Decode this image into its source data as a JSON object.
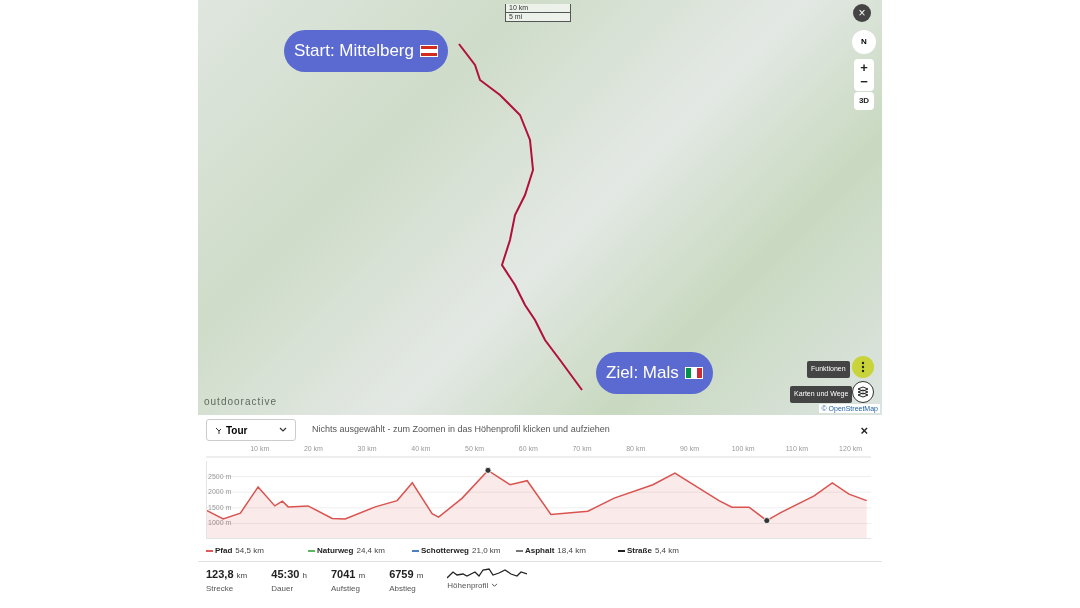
{
  "map": {
    "scale": [
      "10 km",
      "5 mi"
    ],
    "callouts": [
      {
        "text": "Start: Mittelberg",
        "kind": "start"
      },
      {
        "text": "Ziel: Mals",
        "kind": "end"
      }
    ],
    "controls": {
      "close": "×",
      "compass": "N",
      "zoom_in": "+",
      "zoom_out": "−",
      "mode": "3D"
    },
    "tooltips": [
      {
        "text": "Funktionen",
        "kind": "menu"
      },
      {
        "text": "Karten und Wege",
        "kind": "layers"
      }
    ],
    "logo": "outdooractive",
    "attribution": "© OpenStreetMap"
  },
  "profile": {
    "dropdown": "Tour",
    "hint": "Nichts ausgewählt - zum Zoomen in das Höhenprofil klicken und aufziehen",
    "close": "×",
    "chart_data": {
      "type": "area",
      "grid": true,
      "xlim": [
        0,
        123.8
      ],
      "ylim": [
        500,
        3000
      ],
      "xticks": [
        {
          "value": 10,
          "label": "10 km"
        },
        {
          "value": 20,
          "label": "20 km"
        },
        {
          "value": 30,
          "label": "30 km"
        },
        {
          "value": 40,
          "label": "40 km"
        },
        {
          "value": 50,
          "label": "50 km"
        },
        {
          "value": 60,
          "label": "60 km"
        },
        {
          "value": 70,
          "label": "70 km"
        },
        {
          "value": 80,
          "label": "80 km"
        },
        {
          "value": 90,
          "label": "90 km"
        },
        {
          "value": 100,
          "label": "100 km"
        },
        {
          "value": 110,
          "label": "110 km"
        },
        {
          "value": 120,
          "label": "120 km"
        }
      ],
      "yticks": [
        {
          "value": 1000,
          "label": "1000 m"
        },
        {
          "value": 1500,
          "label": "1500 m"
        },
        {
          "value": 2000,
          "label": "2000 m"
        },
        {
          "value": 2500,
          "label": "2500 m"
        }
      ],
      "x": [
        0.1,
        3.2,
        6.4,
        9.7,
        12.8,
        14.2,
        15.3,
        19,
        23.5,
        25.9,
        31.5,
        35.6,
        38.4,
        42.1,
        43.3,
        47.7,
        52.5,
        56.6,
        59.8,
        64.2,
        71.1,
        76,
        83.2,
        87.3,
        95.5,
        97.9,
        101.1,
        104.4,
        106.8,
        113.2,
        116.6,
        119.7,
        123
      ],
      "series": [
        {
          "color": "#d9534f",
          "values": [
            1420,
            1140,
            1330,
            2170,
            1560,
            1710,
            1530,
            1560,
            1160,
            1140,
            1530,
            1730,
            2300,
            1310,
            1200,
            1810,
            2700,
            2240,
            2370,
            1290,
            1390,
            1810,
            2240,
            2610,
            1730,
            1520,
            1520,
            1090,
            1330,
            1880,
            2300,
            1940,
            1730
          ]
        }
      ]
    },
    "legend": [
      {
        "name": "Pfad",
        "value": "54,5 km",
        "color": "#e05a5a"
      },
      {
        "name": "Naturweg",
        "value": "24,4 km",
        "color": "#5cb85c"
      },
      {
        "name": "Schotterweg",
        "value": "21,0 km",
        "color": "#4a7fc1"
      },
      {
        "name": "Asphalt",
        "value": "18,4 km",
        "color": "#777777"
      },
      {
        "name": "Straße",
        "value": "5,4 km",
        "color": "#222222"
      }
    ],
    "stats": [
      {
        "value": "123,8",
        "unit": "km",
        "label": "Strecke"
      },
      {
        "value": "45:30",
        "unit": "h",
        "label": "Dauer"
      },
      {
        "value": "7041",
        "unit": "m",
        "label": "Aufstieg"
      },
      {
        "value": "6759",
        "unit": "m",
        "label": "Abstieg"
      }
    ],
    "profile_toggle": "Höhenprofil"
  }
}
